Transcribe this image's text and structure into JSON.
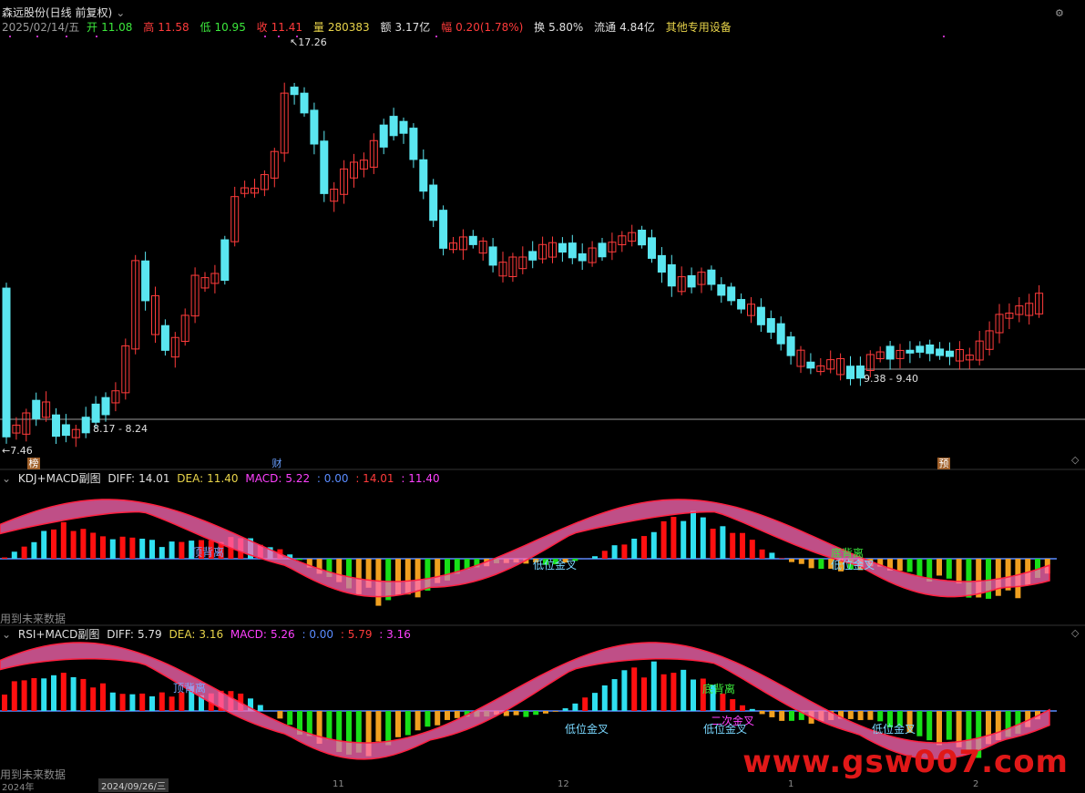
{
  "quote": {
    "title": "森远股份(日线 前复权)",
    "date": "2025/02/14/五",
    "open_label": "开",
    "open": "11.08",
    "high_label": "高",
    "high": "11.58",
    "low_label": "低",
    "low": "10.95",
    "close_label": "收",
    "close": "11.41",
    "vol_label": "量",
    "vol": "280383",
    "amt_label": "额",
    "amt": "3.17亿",
    "chg_label": "幅",
    "chg": "0.20(1.78%)",
    "turn_label": "换",
    "turn": "5.80%",
    "float_label": "流通",
    "float": "4.84亿",
    "sector": "其他专用设备"
  },
  "main_chart": {
    "max_label": "17.26",
    "min_label": "7.46",
    "range1": "8.17 - 8.24",
    "range2": "9.38 - 9.40",
    "badges": {
      "b1": "榜",
      "b2": "财",
      "b3": "预"
    }
  },
  "panel1": {
    "name": "KDJ+MACD副图",
    "diff_label": "DIFF:",
    "diff": "14.01",
    "dea_label": "DEA:",
    "dea": "11.40",
    "macd_label": "MACD:",
    "macd": "5.22",
    "v1": ": 0.00",
    "v2": ": 14.01",
    "v3": ": 11.40",
    "ann_top_div": "顶背离",
    "ann_gold1": "低位金叉",
    "ann_bottom_div": "底背离",
    "ann_gold2": "低位金叉",
    "footer": "用到未来数据"
  },
  "panel2": {
    "name": "RSI+MACD副图",
    "diff_label": "DIFF:",
    "diff": "5.79",
    "dea_label": "DEA:",
    "dea": "3.16",
    "macd_label": "MACD:",
    "macd": "5.26",
    "v1": ": 0.00",
    "v2": ": 5.79",
    "v3": ": 3.16",
    "ann_top_div": "顶背离",
    "ann_gold1": "低位金叉",
    "ann_bottom_div": "底背离",
    "ann_second_gold": "二次金叉",
    "ann_gold2": "低位金叉",
    "ann_gold3": "低位金叉",
    "footer": "用到未来数据"
  },
  "axis": {
    "date_label": "2024/09/26/三",
    "year_label": "2024年",
    "m11": "11",
    "m12": "12",
    "m1": "1",
    "m2": "2"
  },
  "watermark": "www.gsw007.com",
  "colors": {
    "up": "#ff3b3b",
    "down": "#5ae6f0",
    "bg": "#000000",
    "macd_up": "#ff1010",
    "macd_down_dark": "#18e018",
    "macd_down_light": "#f0a020"
  }
}
